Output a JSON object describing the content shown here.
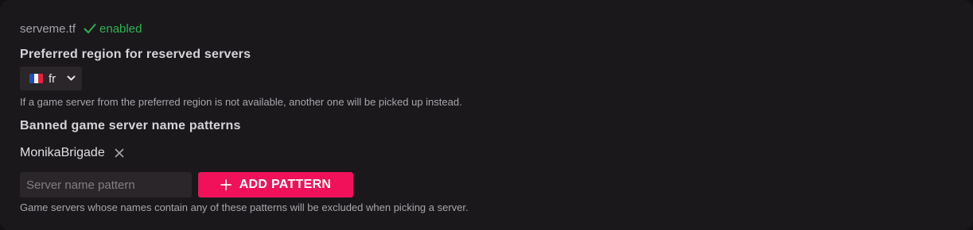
{
  "provider": {
    "name": "serveme.tf",
    "status": "enabled",
    "status_color": "#2fb451"
  },
  "region": {
    "title": "Preferred region for reserved servers",
    "selected": "fr",
    "flag": "france-flag",
    "hint": "If a game server from the preferred region is not available, another one will be picked up instead."
  },
  "banned": {
    "title": "Banned game server name patterns",
    "patterns": [
      {
        "label": "MonikaBrigade"
      }
    ],
    "input_placeholder": "Server name pattern",
    "input_value": "",
    "add_button_label": "ADD PATTERN",
    "add_button_color": "#f0115a",
    "hint": "Game servers whose names contain any of these patterns will be excluded when picking a server."
  }
}
